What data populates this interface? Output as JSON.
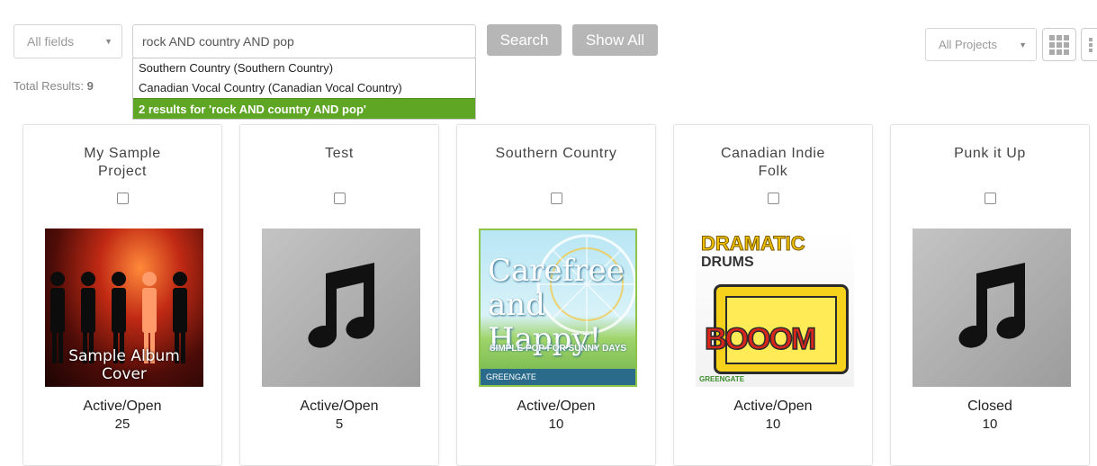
{
  "filters": {
    "field_select": "All fields",
    "project_select": "All Projects"
  },
  "search": {
    "value": "rock AND country AND pop",
    "button": "Search",
    "show_all": "Show All",
    "suggestions": [
      "Southern Country (Southern Country)",
      "Canadian Vocal Country (Canadian Vocal Country)"
    ],
    "results_summary": "2 results for 'rock AND country AND pop'"
  },
  "total": {
    "label": "Total Results:",
    "value": "9"
  },
  "icons": {
    "grid_view": "grid-icon",
    "list_view": "list-icon",
    "music_note": "music-note-icon",
    "dropdown_caret": "chevron-down-icon"
  },
  "colors": {
    "button_gray": "#b6b6b6",
    "result_green": "#5ea624",
    "secondary_count": "#3d9b1f"
  },
  "cards": [
    {
      "title": "My Sample Project",
      "status": "Active/Open",
      "count": "25",
      "art": "Sample Album Cover"
    },
    {
      "title": "Test",
      "status": "Active/Open",
      "count": "5",
      "art": ""
    },
    {
      "title": "Southern Country",
      "status": "Active/Open",
      "count": "10",
      "art": "Carefree and Happy!",
      "art_sub": "SIMPLE POP FOR SUNNY DAYS",
      "art_foot": "GREENGATE"
    },
    {
      "title": "Canadian Indie Folk",
      "status": "Active/Open",
      "count": "10",
      "art": "DRAMATIC",
      "art_sub": "DRUMS",
      "art_boom": "BOOOM",
      "art_foot": "GREENGATE"
    },
    {
      "title": "Punk it Up",
      "status": "Closed",
      "count": "10",
      "art": ""
    }
  ]
}
